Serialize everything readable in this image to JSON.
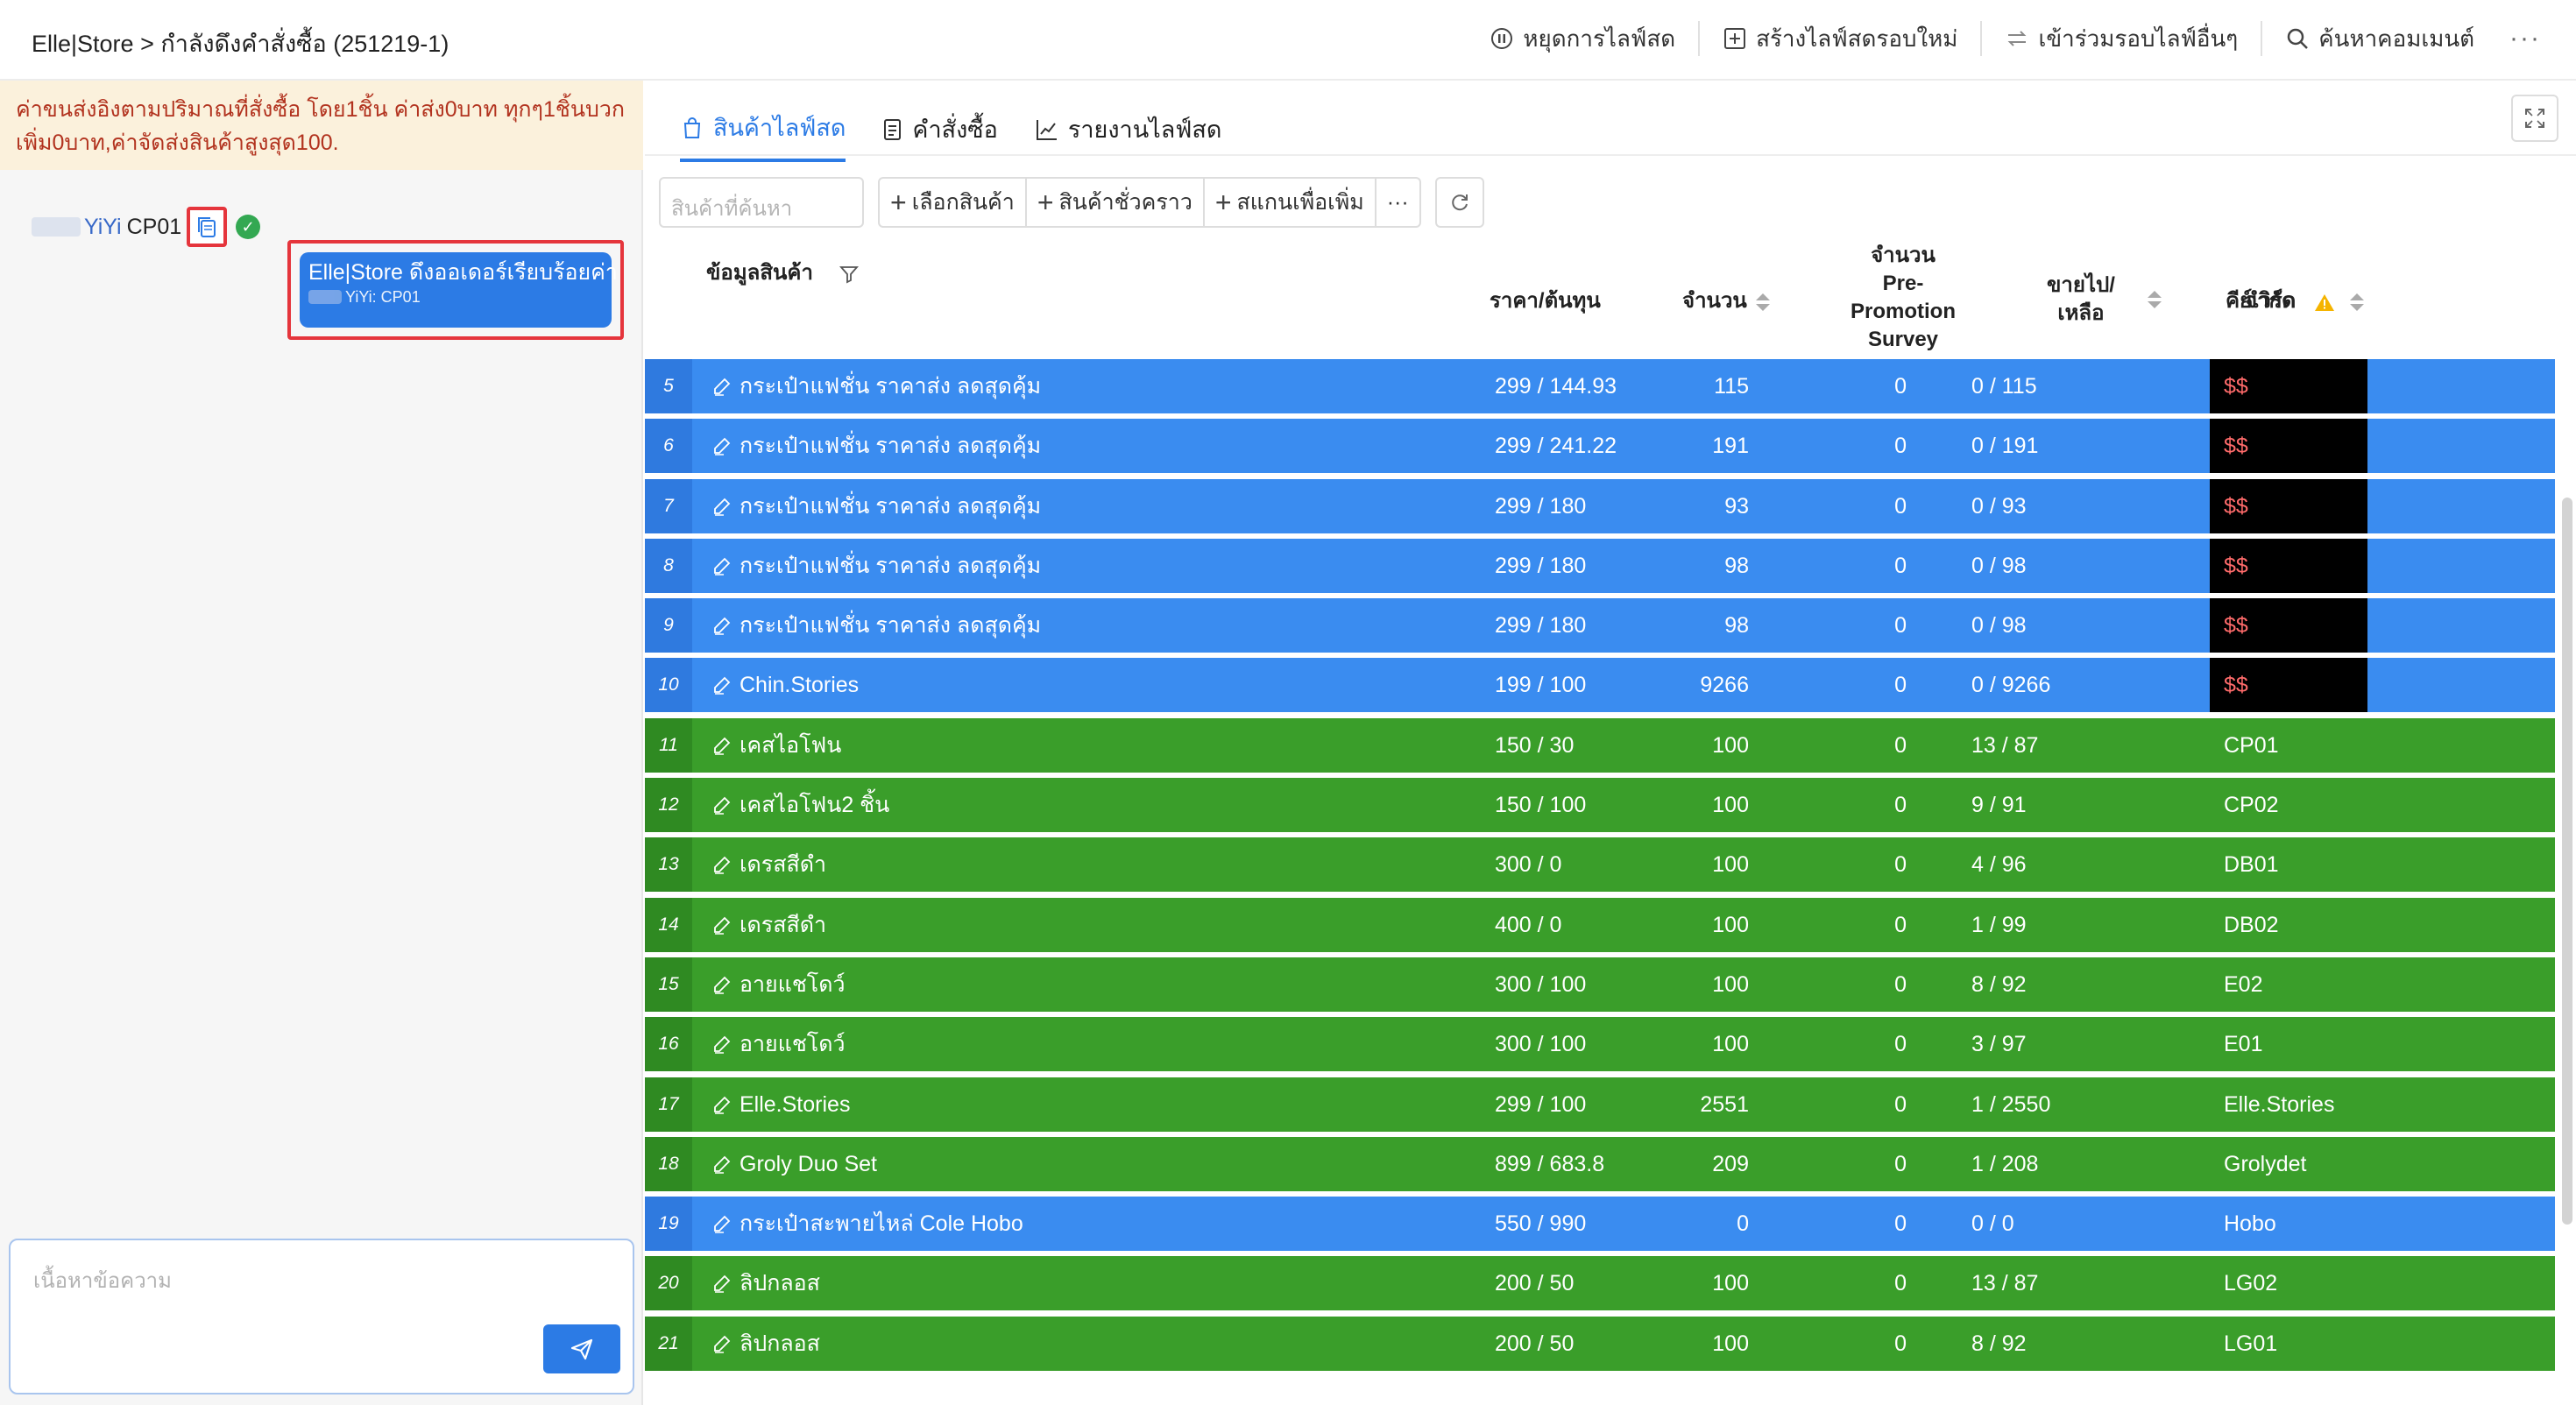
{
  "header": {
    "breadcrumb": "Elle|Store > กำลังดึงคำสั่งซื้อ (251219-1)",
    "actions": [
      {
        "label": "หยุดการไลฟ์สด",
        "icon": "pause-circle-icon"
      },
      {
        "label": "สร้างไลฟ์สดรอบใหม่",
        "icon": "plus-square-icon"
      },
      {
        "label": "เข้าร่วมรอบไลฟ์อื่นๆ",
        "icon": "swap-icon"
      },
      {
        "label": "ค้นหาคอมเมนต์",
        "icon": "search-icon"
      }
    ],
    "more": "···"
  },
  "chat": {
    "notice": "ค่าขนส่งอิงตามปริมาณที่สั่งซื้อ โดย1ชิ้น ค่าส่ง0บาท ทุกๆ1ชิ้นบวกเพิ่ม0บาท,ค่าจัดส่งสินค้าสูงสุด100.",
    "user_name": "YiYi",
    "user_code": "CP01",
    "reply_title": "Elle|Store ดึงออเดอร์เรียบร้อยค่า",
    "reply_sub": "YiYi: CP01",
    "input_placeholder": "เนื้อหาข้อความ"
  },
  "tabs": [
    {
      "label": "สินค้าไลฟ์สด",
      "active": true
    },
    {
      "label": "คำสั่งซื้อ",
      "active": false
    },
    {
      "label": "รายงานไลฟ์สด",
      "active": false
    }
  ],
  "toolbar": {
    "search_placeholder": "สินค้าที่ค้นหา",
    "select_product": "เลือกสินค้า",
    "temp_product": "สินค้าชั่วคราว",
    "scan_add": "สแกนเพื่อเพิ่ม",
    "more": "···"
  },
  "table": {
    "headers": {
      "product": "ข้อมูลสินค้า",
      "price": "ราคา/ต้นทุน",
      "qty": "จำนวน",
      "pre_l1": "จำนวน",
      "pre_l2": "Pre-",
      "pre_l3": "Promotion",
      "pre_l4": "Survey",
      "sold_l1": "ขายไป/",
      "sold_l2": "เหลือ",
      "limit": "จำกัด",
      "keyword": "คีย์เวิร์ด"
    },
    "rows": [
      {
        "n": "5",
        "name": "กระเป๋าแฟชั่น ราคาส่ง ลดสุดคุ้ม",
        "price": "299  /  144.93",
        "qty": "115",
        "pre": "0",
        "sold": "0  /  115",
        "kw": "$$",
        "color": "blue",
        "kwdark": true
      },
      {
        "n": "6",
        "name": "กระเป๋าแฟชั่น ราคาส่ง ลดสุดคุ้ม",
        "price": "299  /  241.22",
        "qty": "191",
        "pre": "0",
        "sold": "0  /  191",
        "kw": "$$",
        "color": "blue",
        "kwdark": true
      },
      {
        "n": "7",
        "name": "กระเป๋าแฟชั่น ราคาส่ง ลดสุดคุ้ม",
        "price": "299  /  180",
        "qty": "93",
        "pre": "0",
        "sold": "0  /  93",
        "kw": "$$",
        "color": "blue",
        "kwdark": true
      },
      {
        "n": "8",
        "name": "กระเป๋าแฟชั่น ราคาส่ง ลดสุดคุ้ม",
        "price": "299  /  180",
        "qty": "98",
        "pre": "0",
        "sold": "0  /  98",
        "kw": "$$",
        "color": "blue",
        "kwdark": true
      },
      {
        "n": "9",
        "name": "กระเป๋าแฟชั่น ราคาส่ง ลดสุดคุ้ม",
        "price": "299  /  180",
        "qty": "98",
        "pre": "0",
        "sold": "0  /  98",
        "kw": "$$",
        "color": "blue",
        "kwdark": true
      },
      {
        "n": "10",
        "name": "Chin.Stories",
        "price": "199  /  100",
        "qty": "9266",
        "pre": "0",
        "sold": "0  /  9266",
        "kw": "$$",
        "color": "blue",
        "kwdark": true
      },
      {
        "n": "11",
        "name": "เคสไอโฟน",
        "price": "150  /  30",
        "qty": "100",
        "pre": "0",
        "sold": "13  /  87",
        "kw": "CP01",
        "color": "green",
        "kwdark": false
      },
      {
        "n": "12",
        "name": "เคสไอโฟน2 ชิ้น",
        "price": "150  /  100",
        "qty": "100",
        "pre": "0",
        "sold": "9  /  91",
        "kw": "CP02",
        "color": "green",
        "kwdark": false
      },
      {
        "n": "13",
        "name": "เดรสสีดำ",
        "price": "300  /  0",
        "qty": "100",
        "pre": "0",
        "sold": "4  /  96",
        "kw": "DB01",
        "color": "green",
        "kwdark": false
      },
      {
        "n": "14",
        "name": "เดรสสีดำ",
        "price": "400  /  0",
        "qty": "100",
        "pre": "0",
        "sold": "1  /  99",
        "kw": "DB02",
        "color": "green",
        "kwdark": false
      },
      {
        "n": "15",
        "name": "อายแชโดว์",
        "price": "300  /  100",
        "qty": "100",
        "pre": "0",
        "sold": "8  /  92",
        "kw": "E02",
        "color": "green",
        "kwdark": false
      },
      {
        "n": "16",
        "name": "อายแชโดว์",
        "price": "300  /  100",
        "qty": "100",
        "pre": "0",
        "sold": "3  /  97",
        "kw": "E01",
        "color": "green",
        "kwdark": false
      },
      {
        "n": "17",
        "name": "Elle.Stories",
        "price": "299  /  100",
        "qty": "2551",
        "pre": "0",
        "sold": "1  /  2550",
        "kw": "Elle.Stories",
        "color": "green",
        "kwdark": false
      },
      {
        "n": "18",
        "name": "Groly Duo Set",
        "price": "899  /  683.8",
        "qty": "209",
        "pre": "0",
        "sold": "1  /  208",
        "kw": "Grolydet",
        "color": "green",
        "kwdark": false
      },
      {
        "n": "19",
        "name": "กระเป๋าสะพายไหล่ Cole Hobo",
        "price": "550  /  990",
        "qty": "0",
        "pre": "0",
        "sold": "0  /  0",
        "kw": "Hobo",
        "color": "blue",
        "kwdark": false
      },
      {
        "n": "20",
        "name": "ลิปกลอส",
        "price": "200  /  50",
        "qty": "100",
        "pre": "0",
        "sold": "13  /  87",
        "kw": "LG02",
        "color": "green",
        "kwdark": false
      },
      {
        "n": "21",
        "name": "ลิปกลอส",
        "price": "200  /  50",
        "qty": "100",
        "pre": "0",
        "sold": "8  /  92",
        "kw": "LG01",
        "color": "green",
        "kwdark": false
      }
    ]
  }
}
